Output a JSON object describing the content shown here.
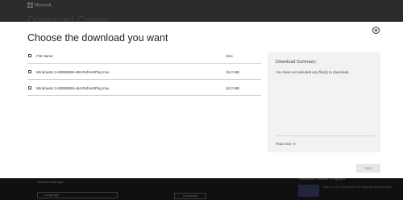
{
  "background": {
    "brand": "Microsoft",
    "page_title": "Download Center",
    "select_label": "Select the file type",
    "select_value": "Language",
    "button_label": "Download",
    "right_heading": "Windows Insider Program",
    "right_text": "Stay on top of Windows 10 features and updates"
  },
  "modal": {
    "title": "Choose the download you want",
    "table": {
      "headers": {
        "name": "File Name",
        "size": "Size"
      },
      "rows": [
        {
          "name": "Windows6.1-KB958559-x86-RefreshPkg.msu",
          "size": "15.3 MB",
          "checked": false
        },
        {
          "name": "Windows6.1-KB958559-x64-RefreshPkg.msu",
          "size": "16.3 MB",
          "checked": false
        }
      ]
    },
    "summary": {
      "title": "Download Summary:",
      "message": "You have not selected any file(s) to download.",
      "total": "Total Size: 0"
    },
    "next_label": "Next"
  },
  "colors": {
    "overlay": "#1a1a1a",
    "modal_bg": "#ffffff",
    "summary_bg": "#f2f2f2",
    "button_disabled_bg": "#e6e6e6"
  },
  "icons": {
    "close": "close-icon",
    "checkbox": "checkbox-icon"
  }
}
